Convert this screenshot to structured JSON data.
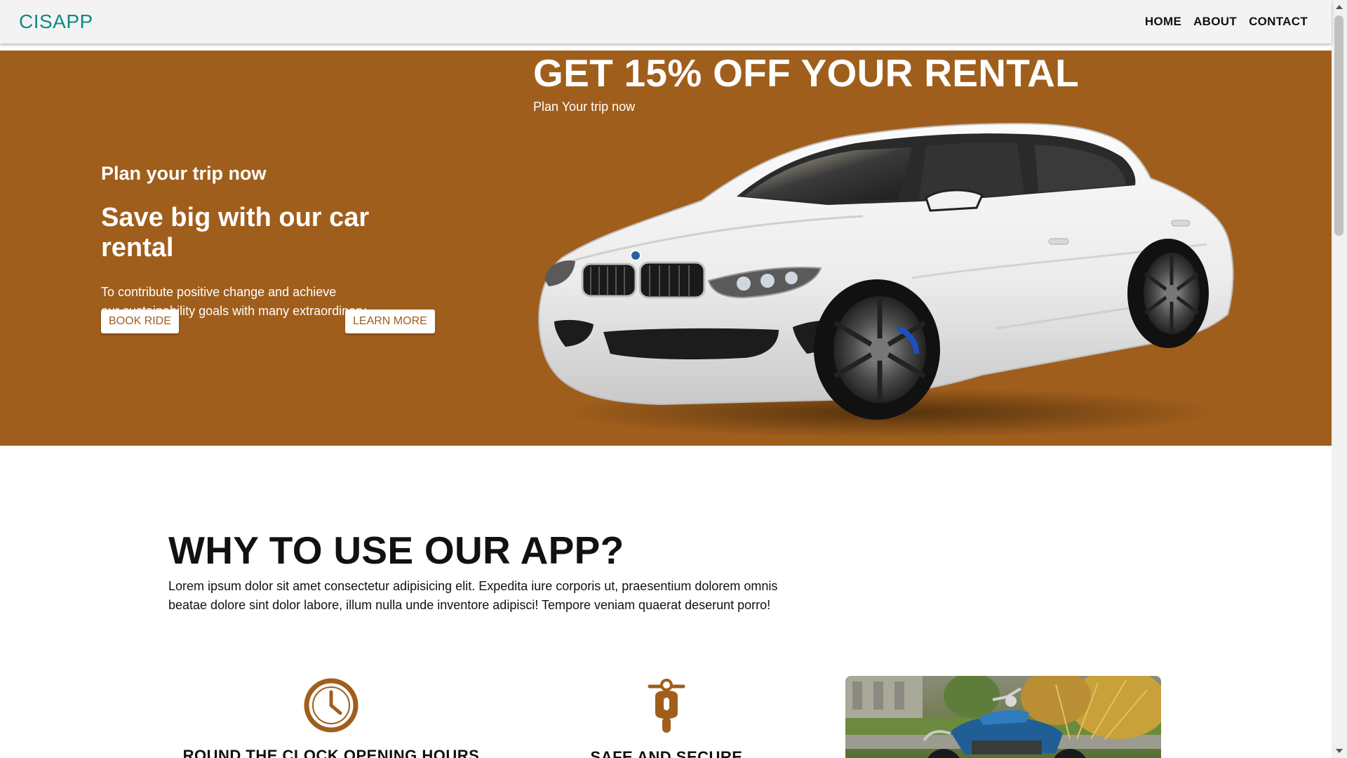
{
  "nav": {
    "brand": "CISAPP",
    "links": [
      "HOME",
      "ABOUT",
      "CONTACT"
    ]
  },
  "hero": {
    "subtitle": "Plan your trip now",
    "title": "Save big with our car rental",
    "description_lines": [
      "To contribute positive change and achieve",
      "our sustainability goals with many extraordinary"
    ],
    "book_button": "BOOK RIDE",
    "learn_button": "LEARN MORE",
    "promo_title": "GET 15% OFF YOUR RENTAL",
    "promo_subtitle": "Plan Your trip now"
  },
  "why": {
    "title": "WHY TO USE OUR APP?",
    "text_lines": [
      "Lorem ipsum dolor sit amet consectetur adipisicing elit. Expedita iure corporis ut, praesentium dolorem omnis",
      "beatae dolore sint dolor labore, illum nulla unde inventore adipisci! Tempore veniam quaerat deserunt porro!"
    ]
  },
  "features": [
    {
      "icon": "clock-icon",
      "title": "ROUND THE CLOCK OPENING HOURS"
    },
    {
      "icon": "scooter-icon",
      "title": "SAFE AND SECURE"
    }
  ],
  "colors": {
    "hero_bg": "#a05e1c",
    "brand": "#108a86",
    "accent": "#a05e1c"
  }
}
